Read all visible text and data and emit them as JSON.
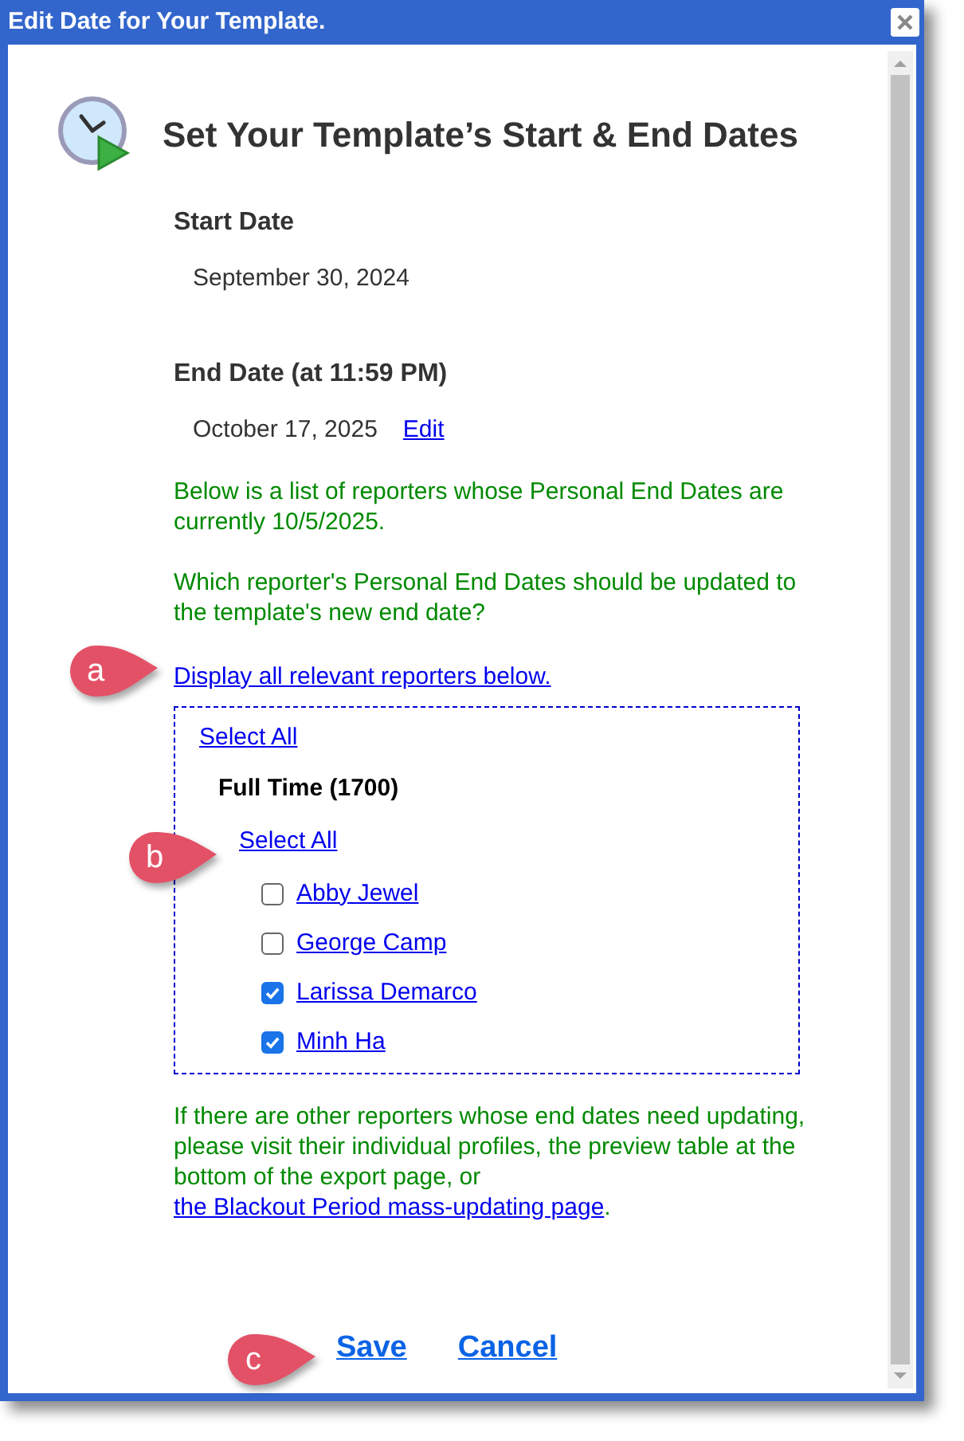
{
  "window": {
    "title": "Edit Date for Your Template."
  },
  "heading": "Set Your Template’s Start & End Dates",
  "start_date": {
    "label": "Start Date",
    "value": "September 30, 2024"
  },
  "end_date": {
    "label": "End Date (at 11:59 PM)",
    "value": "October 17, 2025",
    "edit_link": "Edit"
  },
  "info_paragraphs": [
    "Below is a list of reporters whose Personal End Dates are currently 10/5/2025.",
    "Which reporter's Personal End Dates should be updated to the template's new end date?"
  ],
  "display_link": "Display all relevant reporters below.",
  "selection": {
    "select_all": "Select All",
    "groups": [
      {
        "name": "Full Time (1700)",
        "select_all": "Select All",
        "reporters": [
          {
            "name": "Abby Jewel",
            "checked": false
          },
          {
            "name": "George Camp",
            "checked": false
          },
          {
            "name": "Larissa Demarco",
            "checked": true
          },
          {
            "name": "Minh Ha",
            "checked": true
          }
        ]
      }
    ]
  },
  "footer_note": {
    "text": "If there are other reporters whose end dates need updating, please visit their individual profiles, the preview table at the bottom of the export page, or",
    "link": "the Blackout Period mass-updating page",
    "after": "."
  },
  "buttons": [
    {
      "label": "Save"
    },
    {
      "label": "Cancel"
    }
  ],
  "callouts": [
    {
      "label": "a"
    },
    {
      "label": "b"
    },
    {
      "label": "c"
    }
  ]
}
